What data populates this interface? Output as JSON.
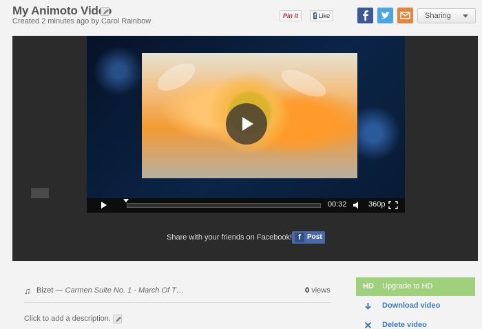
{
  "header": {
    "title": "My Animoto Video",
    "subtitle": "Created 2 minutes ago by Carol Rainbow",
    "pinit_label": "Pin it",
    "like_label": "Like",
    "sharing_label": "Sharing"
  },
  "player": {
    "time": "00:32",
    "quality": "360p",
    "progress": 0.0
  },
  "facebook_share": {
    "message": "Share with your friends on Facebook!",
    "post_label": "Post"
  },
  "details": {
    "track_artist": "Bizet",
    "track_separator": "—",
    "track_title": "Carmen Suite No. 1 - March Of T…",
    "views_count": "0",
    "views_label": "views",
    "description_prompt": "Click to add a description."
  },
  "sidebar": {
    "hd_badge": "HD",
    "upgrade_label": "Upgrade to HD",
    "download_label": "Download video",
    "delete_label": "Delete video"
  },
  "colors": {
    "facebook": "#3b5998",
    "twitter": "#4aa5e2",
    "email": "#e8833a",
    "hd_green": "#9fd07c",
    "link_blue": "#3d7bbd"
  },
  "icons": [
    "pencil-icon",
    "facebook-icon",
    "twitter-icon",
    "email-icon",
    "chevron-down-icon",
    "play-icon",
    "volume-icon",
    "fullscreen-icon",
    "music-note-icon",
    "download-icon",
    "close-icon"
  ]
}
